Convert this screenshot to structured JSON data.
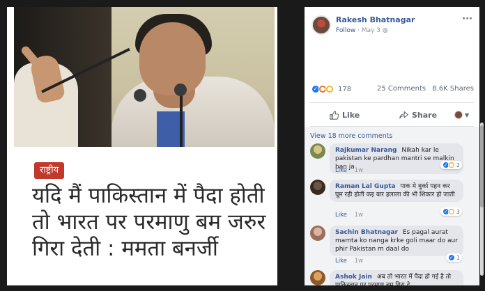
{
  "news": {
    "tag": "राष्ट्रीय",
    "headline": "यदि मैं पाकिस्तान में पैदा होती तो भारत पर परमाणु बम जरुर गिरा देती : ममता बनर्जी"
  },
  "post": {
    "author": "Rakesh Bhatnagar",
    "follow": "Follow",
    "date": "May 3",
    "reaction_count": "178",
    "comments": "25 Comments",
    "shares": "8.6K Shares",
    "like_label": "Like",
    "share_label": "Share",
    "view_more": "View 18 more comments"
  },
  "comments": [
    {
      "name": "Rajkumar Narang",
      "text": "Nikah kar le pakistan ke pardhan mantri se malkin ban ja",
      "like": "Like",
      "time": "1w",
      "rx_count": "2"
    },
    {
      "name": "Raman Lal Gupta",
      "text": "पाक मे बुर्का पहन कर घूम रही होती कइ बार हलाला की भी शिकार हो जाती",
      "like": "Like",
      "time": "1w",
      "rx_count": "3"
    },
    {
      "name": "Sachin Bhatnagar",
      "text": "Es pagal aurat mamta ko nanga krke goli maar do aur phir Pakistan m daal do",
      "like": "Like",
      "time": "1w",
      "rx_count": "1"
    },
    {
      "name": "Ashok Jain",
      "text": "अब तो भारत में पैदा हो गई है तो पाकिस्तान पर परमाणु बम गिरा दे",
      "like": "",
      "time": "",
      "rx_count": ""
    }
  ],
  "colors": {
    "link": "#385898",
    "tag_bg": "#c0392b",
    "like_blue": "#2078f4"
  }
}
